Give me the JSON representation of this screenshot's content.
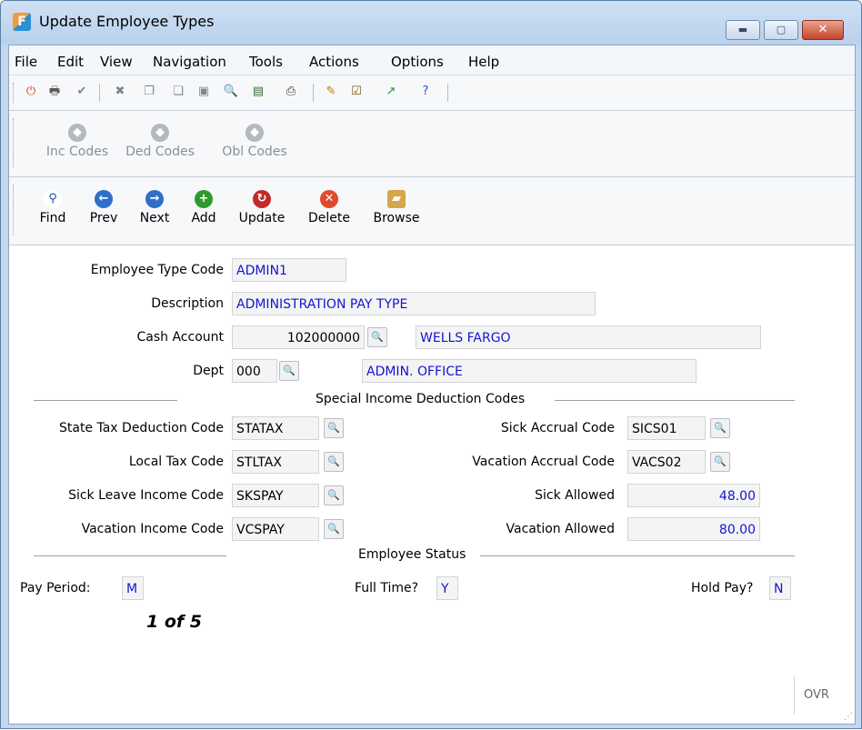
{
  "window": {
    "title": "Update Employee Types",
    "controls": {
      "minimize": "▬",
      "maximize": "▢",
      "close": "✕"
    }
  },
  "menu": [
    "File",
    "Edit",
    "View",
    "Navigation",
    "Tools",
    "Actions",
    "Options",
    "Help"
  ],
  "toolbar_icons": [
    {
      "name": "power-icon",
      "glyph": "⏻",
      "color": "#d8401e"
    },
    {
      "name": "print-icon",
      "glyph": "🖶",
      "color": "#555555"
    },
    {
      "name": "check-icon",
      "glyph": "✔",
      "color": "#7d8590"
    },
    {
      "name": "cancel-icon",
      "glyph": "✖",
      "color": "#7d8590"
    },
    {
      "name": "copy-icon",
      "glyph": "❐",
      "color": "#7d8590"
    },
    {
      "name": "paste-icon",
      "glyph": "❏",
      "color": "#7d8590"
    },
    {
      "name": "select-icon",
      "glyph": "▣",
      "color": "#7d8590"
    },
    {
      "name": "zoom-icon",
      "glyph": "🔍",
      "color": "#333333"
    },
    {
      "name": "notes-icon",
      "glyph": "▤",
      "color": "#2f6b2f"
    },
    {
      "name": "attach-icon",
      "glyph": "⎙",
      "color": "#333333"
    },
    {
      "name": "report-icon",
      "glyph": "✎",
      "color": "#b07a12"
    },
    {
      "name": "checklist-icon",
      "glyph": "☑",
      "color": "#7a5a12"
    },
    {
      "name": "chart-icon",
      "glyph": "↗",
      "color": "#1f9a2f"
    },
    {
      "name": "help-icon",
      "glyph": "?",
      "color": "#1a56c7"
    }
  ],
  "code_buttons": [
    "Inc Codes",
    "Ded Codes",
    "Obl Codes"
  ],
  "nav_buttons": [
    {
      "name": "find",
      "label": "Find",
      "glyph": "🔍",
      "color": "#ffffff"
    },
    {
      "name": "prev",
      "label": "Prev",
      "glyph": "←",
      "color": "#2f6fc9"
    },
    {
      "name": "next",
      "label": "Next",
      "glyph": "→",
      "color": "#2f6fc9"
    },
    {
      "name": "add",
      "label": "Add",
      "glyph": "+",
      "color": "#2e9a2e"
    },
    {
      "name": "update",
      "label": "Update",
      "glyph": "↻",
      "color": "#c22a2a"
    },
    {
      "name": "delete",
      "label": "Delete",
      "glyph": "✕",
      "color": "#e04a2a"
    },
    {
      "name": "browse",
      "label": "Browse",
      "glyph": "▰",
      "color": "#d6a64a"
    }
  ],
  "form": {
    "employee_type_code": {
      "label": "Employee Type Code",
      "value": "ADMIN1"
    },
    "description": {
      "label": "Description",
      "value": "ADMINISTRATION PAY TYPE"
    },
    "cash_account": {
      "label": "Cash Account",
      "value": "102000000",
      "name": "WELLS FARGO"
    },
    "dept": {
      "label": "Dept",
      "value": "000",
      "name": "ADMIN. OFFICE"
    },
    "special_section": "Special Income Deduction Codes",
    "state_tax": {
      "label": "State Tax Deduction Code",
      "value": "STATAX"
    },
    "local_tax": {
      "label": "Local Tax Code",
      "value": "STLTAX"
    },
    "sick_leave_income": {
      "label": "Sick Leave Income Code",
      "value": "SKSPAY"
    },
    "vacation_income": {
      "label": "Vacation Income Code",
      "value": "VCSPAY"
    },
    "sick_accrual": {
      "label": "Sick Accrual Code",
      "value": "SICS01"
    },
    "vacation_accrual": {
      "label": "Vacation Accrual Code",
      "value": "VACS02"
    },
    "sick_allowed": {
      "label": "Sick Allowed",
      "value": "48.00"
    },
    "vacation_allowed": {
      "label": "Vacation Allowed",
      "value": "80.00"
    },
    "status_section": "Employee Status",
    "pay_period": {
      "label": "Pay Period:",
      "value": "M"
    },
    "full_time": {
      "label": "Full Time?",
      "value": "Y"
    },
    "hold_pay": {
      "label": "Hold Pay?",
      "value": "N"
    },
    "record_position": "1 of 5"
  },
  "statusbar": {
    "mode": "OVR"
  }
}
